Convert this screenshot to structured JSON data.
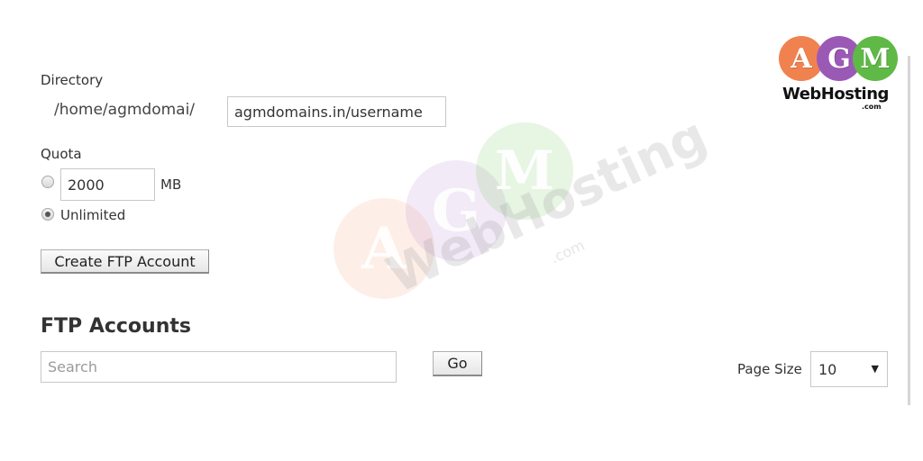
{
  "directory": {
    "label": "Directory",
    "prefix": "/home/agmdomai/",
    "value": "agmdomains.in/username"
  },
  "quota": {
    "label": "Quota",
    "limited_value": "2000",
    "unit": "MB",
    "unlimited_label": "Unlimited",
    "selected": "unlimited"
  },
  "create_button_label": "Create FTP Account",
  "ftp_accounts": {
    "heading": "FTP Accounts",
    "search_placeholder": "Search",
    "go_label": "Go",
    "page_size_label": "Page Size",
    "page_size_value": "10"
  },
  "logo": {
    "letters": [
      "A",
      "G",
      "M"
    ],
    "text": "WebHosting",
    "suffix": ".com",
    "colors": [
      "#f0824f",
      "#9b59b6",
      "#5fb946"
    ]
  },
  "watermark": {
    "letters": [
      "A",
      "G",
      "M"
    ],
    "text": "WebHosting",
    "suffix": ".com"
  }
}
